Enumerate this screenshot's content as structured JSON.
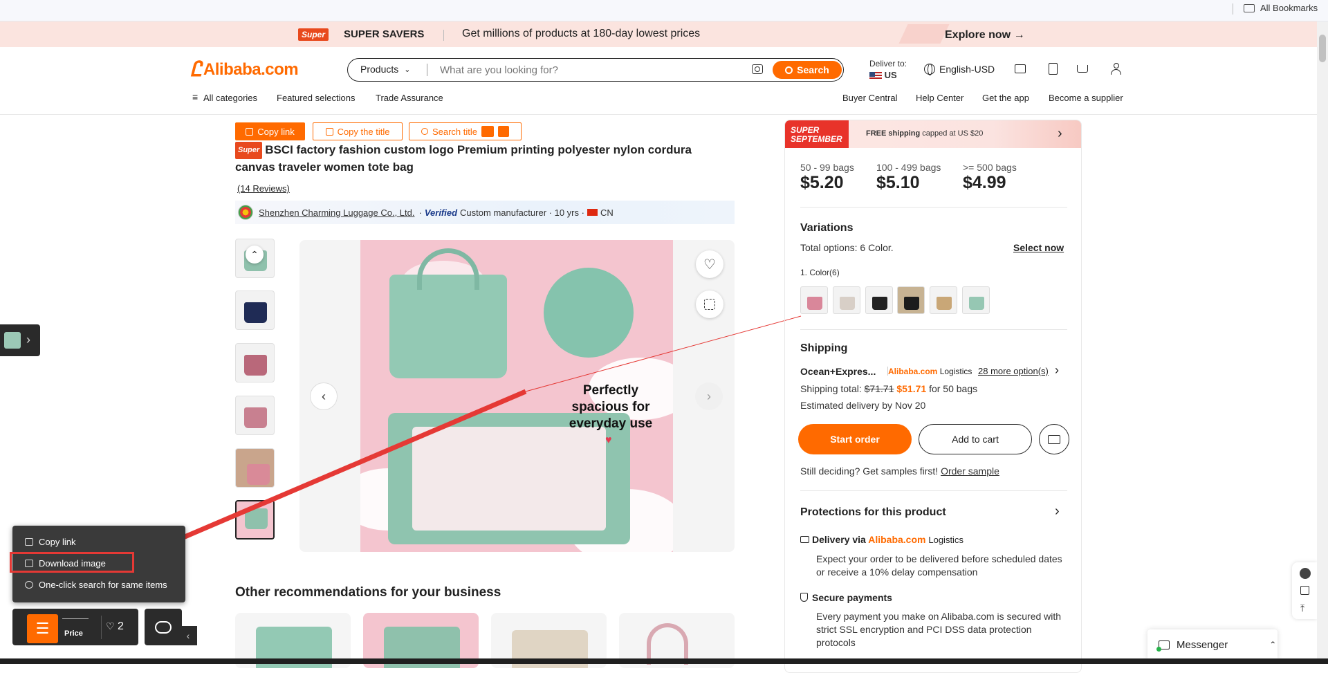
{
  "bookmarks": {
    "all_label": "All Bookmarks"
  },
  "promo": {
    "badge": "Super",
    "title": "SUPER SAVERS",
    "text": "Get millions of products at 180-day lowest prices",
    "cta": "Explore now →"
  },
  "header": {
    "logo": "Alibaba.com",
    "search_category": "Products",
    "search_placeholder": "What are you looking for?",
    "search_button": "Search",
    "deliver_label": "Deliver to:",
    "deliver_country": "US",
    "language": "English-USD"
  },
  "nav": {
    "left": [
      "All categories",
      "Featured selections",
      "Trade Assurance"
    ],
    "right": [
      "Buyer Central",
      "Help Center",
      "Get the app",
      "Become a supplier"
    ]
  },
  "toolbar": {
    "copy_link": "Copy link",
    "copy_title": "Copy the title",
    "search_title": "Search title"
  },
  "product": {
    "badge": "Super",
    "title": "BSCI factory fashion custom logo Premium printing polyester nylon cordura canvas traveler women tote bag",
    "reviews": "(14 Reviews)",
    "supplier_name": "Shenzhen Charming Luggage Co., Ltd.",
    "verified": "Verified",
    "supplier_meta_a": "Custom manufacturer · 10 yrs ·",
    "supplier_country": "CN",
    "image_text": "Perfectly spacious for everyday use"
  },
  "panel": {
    "promo_badge": "SUPER SEPTEMBER",
    "promo_ship_bold": "FREE shipping",
    "promo_ship_rest": "capped at US $20",
    "tiers": [
      {
        "qty": "50 - 99 bags",
        "price": "$5.20"
      },
      {
        "qty": "100 - 499 bags",
        "price": "$5.10"
      },
      {
        "qty": ">= 500 bags",
        "price": "$4.99"
      }
    ],
    "variations_title": "Variations",
    "total_options_label": "Total options:",
    "total_options_value": "6 Color.",
    "select_now": "Select now",
    "color_label": "1. Color(6)",
    "shipping_title": "Shipping",
    "shipping_method": "Ocean+Expres...",
    "logistics_brand": "Alibaba.com",
    "logistics_word": "Logistics",
    "more_options": "28 more option(s)",
    "shipping_total_label": "Shipping total:",
    "shipping_old": "$71.71",
    "shipping_new": "$51.71",
    "shipping_for": "for 50 bags",
    "estimated": "Estimated delivery by Nov 20",
    "start_order": "Start order",
    "add_to_cart": "Add to cart",
    "samples_text": "Still deciding? Get samples first!",
    "order_sample": "Order sample",
    "protections_title": "Protections for this product",
    "delivery_via": "Delivery via",
    "delivery_text": "Expect your order to be delivered before scheduled dates or receive a 10% delay compensation",
    "secure_title": "Secure payments",
    "secure_text": "Every payment you make on Alibaba.com is secured with strict SSL encryption and PCI DSS data protection protocols"
  },
  "context_menu": {
    "items": [
      "Copy link",
      "Download image",
      "One-click search for same items"
    ]
  },
  "bottom_bar": {
    "price_label": "Price",
    "fav_count": "2"
  },
  "recommendations": {
    "title": "Other recommendations for your business"
  },
  "messenger": {
    "label": "Messenger"
  },
  "colors": {
    "accent": "#ff6a00",
    "promo_red": "#e8332a",
    "annotation_red": "#e53935"
  }
}
